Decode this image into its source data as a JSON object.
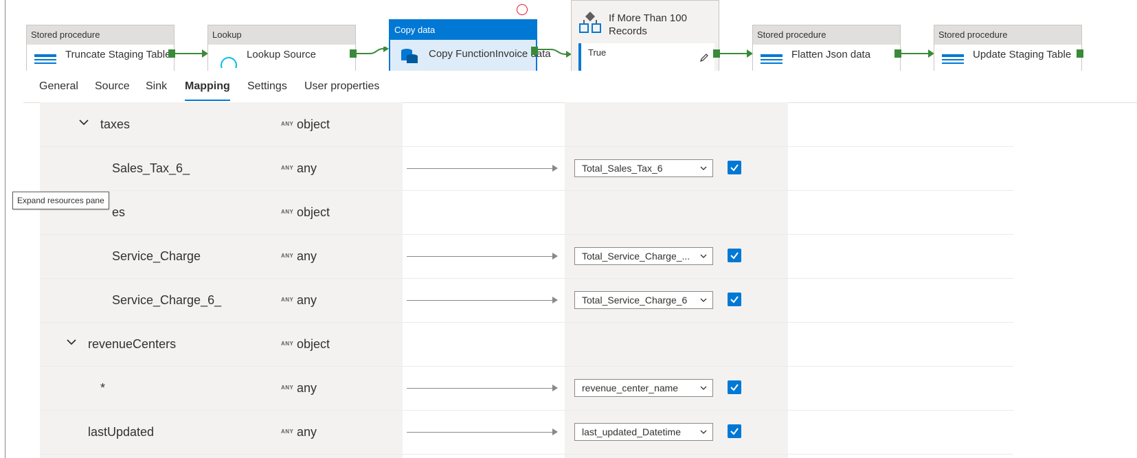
{
  "pipeline": {
    "activities": [
      {
        "type": "Stored procedure",
        "name": "Truncate Staging Table"
      },
      {
        "type": "Lookup",
        "name": "Lookup Source"
      },
      {
        "type": "Copy data",
        "name": "Copy FunctionInvoice data"
      },
      {
        "type": "",
        "name": "If More Than 100 Records",
        "case": "True"
      },
      {
        "type": "Stored procedure",
        "name": "Flatten Json data"
      },
      {
        "type": "Stored procedure",
        "name": "Update Staging Table"
      }
    ]
  },
  "tabs": [
    {
      "label": "General"
    },
    {
      "label": "Source"
    },
    {
      "label": "Sink"
    },
    {
      "label": "Mapping",
      "active": true
    },
    {
      "label": "Settings"
    },
    {
      "label": "User properties"
    }
  ],
  "any_tag": "ANY",
  "rows": [
    {
      "name": "taxes",
      "type": "object",
      "collapsible": true,
      "sink": ""
    },
    {
      "name": "Sales_Tax_6_",
      "type": "any",
      "sink": "Total_Sales_Tax_6",
      "checked": true
    },
    {
      "name": "es",
      "type": "object",
      "sink": ""
    },
    {
      "name": "Service_Charge",
      "type": "any",
      "sink": "Total_Service_Charge_...",
      "checked": true
    },
    {
      "name": "Service_Charge_6_",
      "type": "any",
      "sink": "Total_Service_Charge_6",
      "checked": true
    },
    {
      "name": "revenueCenters",
      "type": "object",
      "collapsible": true,
      "sink": ""
    },
    {
      "name": "*",
      "type": "any",
      "sink": "revenue_center_name",
      "checked": true
    },
    {
      "name": "lastUpdated",
      "type": "any",
      "sink": "last_updated_Datetime",
      "checked": true
    }
  ],
  "tooltip": "Expand resources pane",
  "colors": {
    "accent": "#0078d4",
    "connector": "#3a8a3a",
    "columnBg": "#f3f2f1"
  }
}
